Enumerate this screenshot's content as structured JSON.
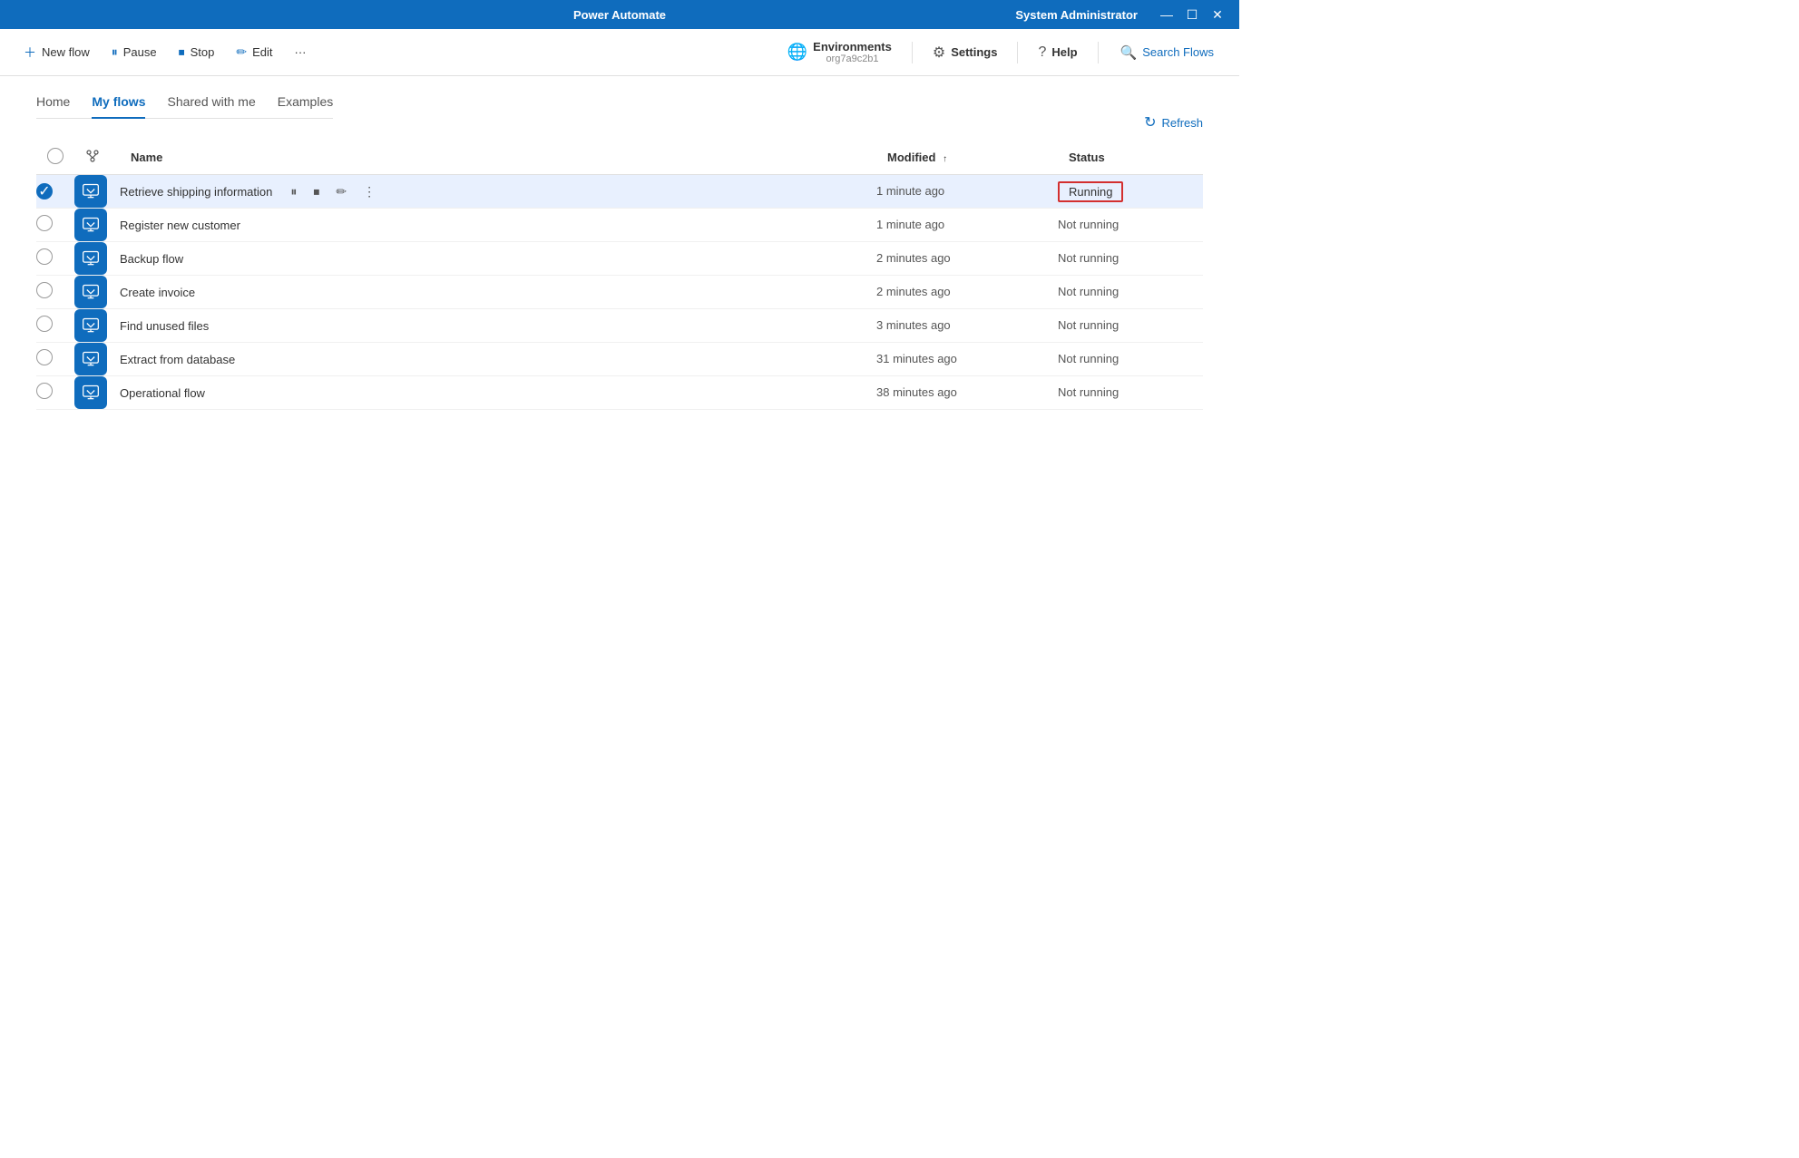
{
  "titleBar": {
    "title": "Power Automate",
    "user": "System Administrator",
    "controls": {
      "minimize": "—",
      "maximize": "☐",
      "close": "✕"
    }
  },
  "toolbar": {
    "newFlow": "New flow",
    "pause": "Pause",
    "stop": "Stop",
    "edit": "Edit",
    "more": "···",
    "environments": "Environments",
    "environmentSub": "org7a9c2b1",
    "settings": "Settings",
    "help": "Help",
    "searchFlows": "Search Flows"
  },
  "nav": {
    "tabs": [
      {
        "id": "home",
        "label": "Home",
        "active": false
      },
      {
        "id": "my-flows",
        "label": "My flows",
        "active": true
      },
      {
        "id": "shared",
        "label": "Shared with me",
        "active": false
      },
      {
        "id": "examples",
        "label": "Examples",
        "active": false
      }
    ]
  },
  "refreshLabel": "Refresh",
  "table": {
    "columns": {
      "name": "Name",
      "modified": "Modified",
      "status": "Status"
    },
    "rows": [
      {
        "id": 1,
        "selected": true,
        "name": "Retrieve shipping information",
        "modified": "1 minute ago",
        "status": "Running",
        "statusRunning": true
      },
      {
        "id": 2,
        "selected": false,
        "name": "Register new customer",
        "modified": "1 minute ago",
        "status": "Not running",
        "statusRunning": false
      },
      {
        "id": 3,
        "selected": false,
        "name": "Backup flow",
        "modified": "2 minutes ago",
        "status": "Not running",
        "statusRunning": false
      },
      {
        "id": 4,
        "selected": false,
        "name": "Create invoice",
        "modified": "2 minutes ago",
        "status": "Not running",
        "statusRunning": false
      },
      {
        "id": 5,
        "selected": false,
        "name": "Find unused files",
        "modified": "3 minutes ago",
        "status": "Not running",
        "statusRunning": false
      },
      {
        "id": 6,
        "selected": false,
        "name": "Extract from database",
        "modified": "31 minutes ago",
        "status": "Not running",
        "statusRunning": false
      },
      {
        "id": 7,
        "selected": false,
        "name": "Operational flow",
        "modified": "38 minutes ago",
        "status": "Not running",
        "statusRunning": false
      }
    ]
  }
}
